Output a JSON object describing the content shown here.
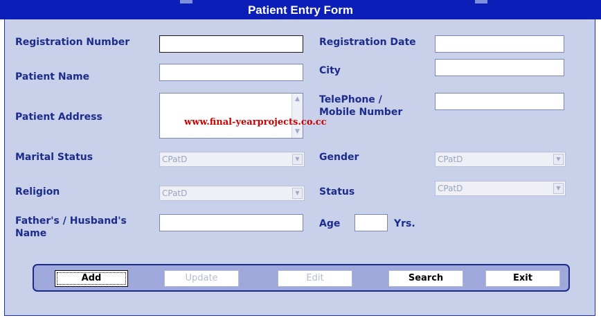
{
  "window": {
    "title": "Patient Entry Form"
  },
  "labels": {
    "registration_number": "Registration Number",
    "registration_date": "Registration Date",
    "patient_name": "Patient Name",
    "city": "City",
    "patient_address": "Patient Address",
    "telephone_line1": "TelePhone /",
    "telephone_line2": "Mobile Number",
    "marital_status": "Marital Status",
    "gender": "Gender",
    "religion": "Religion",
    "status": "Status",
    "father_line1": "Father's / Husband's",
    "father_line2": "Name",
    "age": "Age",
    "years": "Yrs."
  },
  "fields": {
    "registration_number": "",
    "registration_date": "",
    "patient_name": "",
    "city": "",
    "patient_address": "",
    "telephone": "",
    "father_name": "",
    "age": ""
  },
  "combos": {
    "marital_status": "CPatD",
    "gender": "CPatD",
    "religion": "CPatD",
    "status": "CPatD"
  },
  "watermark": "www.final-yearprojects.co.cc",
  "buttons": {
    "add": "Add",
    "update": "Update",
    "edit": "Edit",
    "search": "Search",
    "exit": "Exit"
  }
}
